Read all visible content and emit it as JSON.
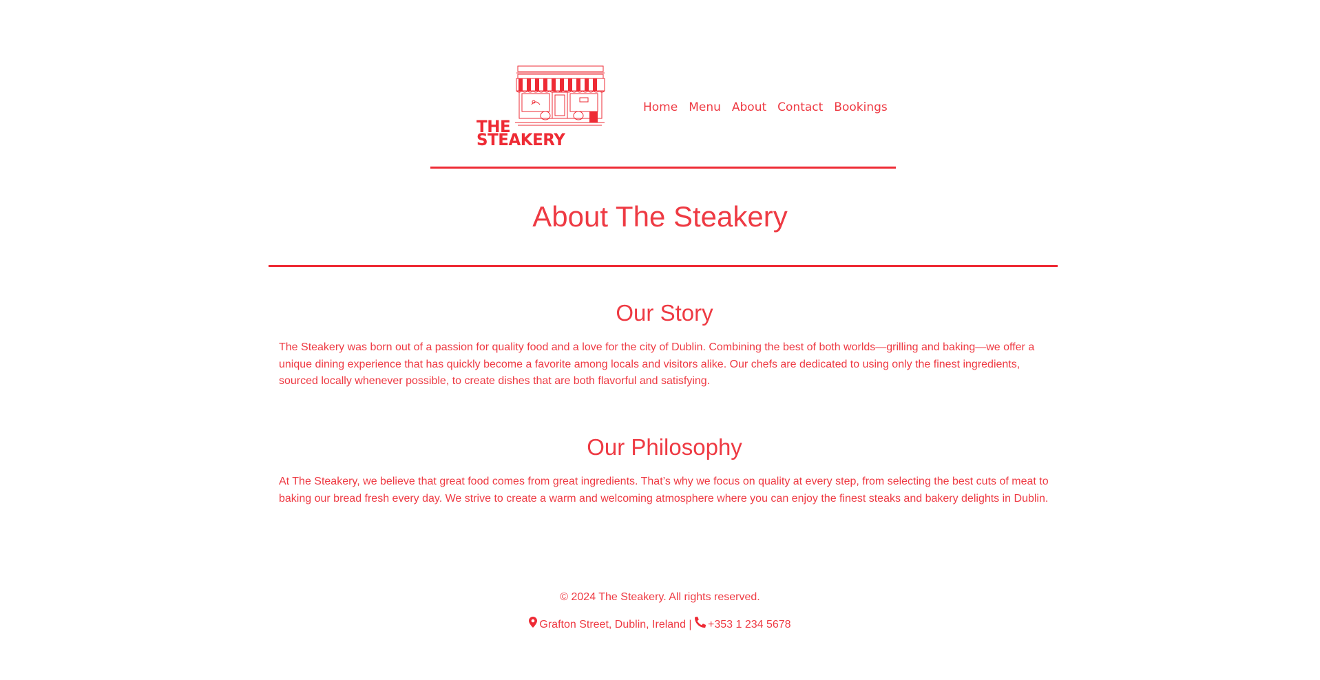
{
  "brand": {
    "logo_line1": "THE",
    "logo_line2": "STEAKERY",
    "logo_icon": "storefront-illustration",
    "accent_color": "#ee3a43"
  },
  "nav": {
    "items": [
      {
        "label": "Home"
      },
      {
        "label": "Menu"
      },
      {
        "label": "About"
      },
      {
        "label": "Contact"
      },
      {
        "label": "Bookings"
      }
    ]
  },
  "page": {
    "title": "About The Steakery"
  },
  "sections": {
    "story": {
      "heading": "Our Story",
      "body": "The Steakery was born out of a passion for quality food and a love for the city of Dublin. Combining the best of both worlds—grilling and baking—we offer a unique dining experience that has quickly become a favorite among locals and visitors alike. Our chefs are dedicated to using only the finest ingredients, sourced locally whenever possible, to create dishes that are both flavorful and satisfying."
    },
    "philosophy": {
      "heading": "Our Philosophy",
      "body": "At The Steakery, we believe that great food comes from great ingredients. That’s why we focus on quality at every step, from selecting the best cuts of meat to baking our bread fresh every day. We strive to create a warm and welcoming atmosphere where you can enjoy the finest steaks and bakery delights in Dublin."
    }
  },
  "footer": {
    "copyright": "© 2024 The Steakery. All rights reserved.",
    "address": "Grafton Street, Dublin, Ireland",
    "separator": " | ",
    "phone": "+353 1 234 5678",
    "address_icon": "map-pin-icon",
    "phone_icon": "phone-icon"
  }
}
